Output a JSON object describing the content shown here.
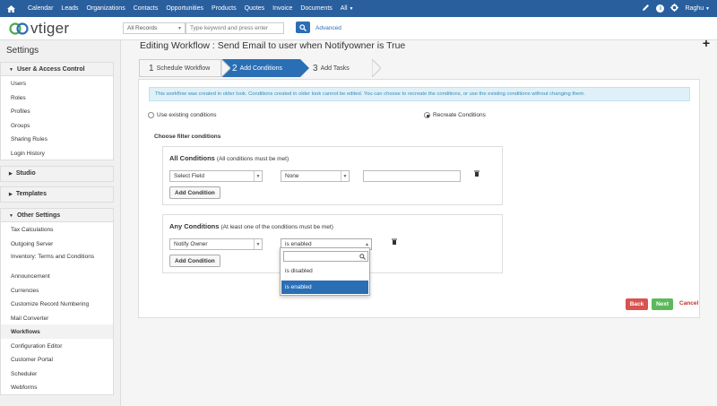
{
  "topnav": {
    "items": [
      "Calendar",
      "Leads",
      "Organizations",
      "Contacts",
      "Opportunities",
      "Products",
      "Quotes",
      "Invoice",
      "Documents",
      "All"
    ],
    "user": "Raghu",
    "accent": "#2a5f9e"
  },
  "header": {
    "logo_text": "vtiger",
    "search_scope": "All Records",
    "search_placeholder": "Type keyword and press enter",
    "advanced_label": "Advanced"
  },
  "sidebar": {
    "title": "Settings",
    "sections": [
      {
        "label": "User & Access Control",
        "items": [
          "Users",
          "Roles",
          "Profiles",
          "Groups",
          "Sharing Rules",
          "Login History"
        ]
      },
      {
        "label": "Studio",
        "items": []
      },
      {
        "label": "Templates",
        "items": []
      },
      {
        "label": "Other Settings",
        "items": [
          "Tax Calculations",
          "Outgoing Server",
          "Inventory: Terms and Conditions",
          "Announcement",
          "Currencies",
          "Customize Record Numbering",
          "Mail Converter",
          "Workflows",
          "Configuration Editor",
          "Customer Portal",
          "Scheduler",
          "Webforms"
        ]
      }
    ]
  },
  "main": {
    "title": "Editing Workflow : Send Email to user when Notifyowner is True",
    "steps": [
      {
        "num": "1",
        "label": "Schedule Workflow"
      },
      {
        "num": "2",
        "label": "Add Conditions"
      },
      {
        "num": "3",
        "label": "Add Tasks"
      }
    ],
    "info_text": "This workflow was created in older look. Conditions created in older look cannot be edited. You can choose to recreate the conditions, or use the existing conditions without changing them.",
    "radio_existing": "Use existing conditions",
    "radio_recreate": "Recreate Conditions",
    "filter_heading": "Choose filter conditions",
    "all_conditions": {
      "title": "All Conditions",
      "subtitle": "(All conditions must be met)",
      "field": "Select Field",
      "operator": "None",
      "add_label": "Add Condition"
    },
    "any_conditions": {
      "title": "Any Conditions",
      "subtitle": "(At least one of the conditions must be met)",
      "field": "Notify Owner",
      "operator": "is enabled",
      "add_label": "Add Condition"
    },
    "dropdown_options": [
      "is disabled",
      "is enabled"
    ],
    "buttons": {
      "back": "Back",
      "next": "Next",
      "cancel": "Cancel"
    }
  }
}
